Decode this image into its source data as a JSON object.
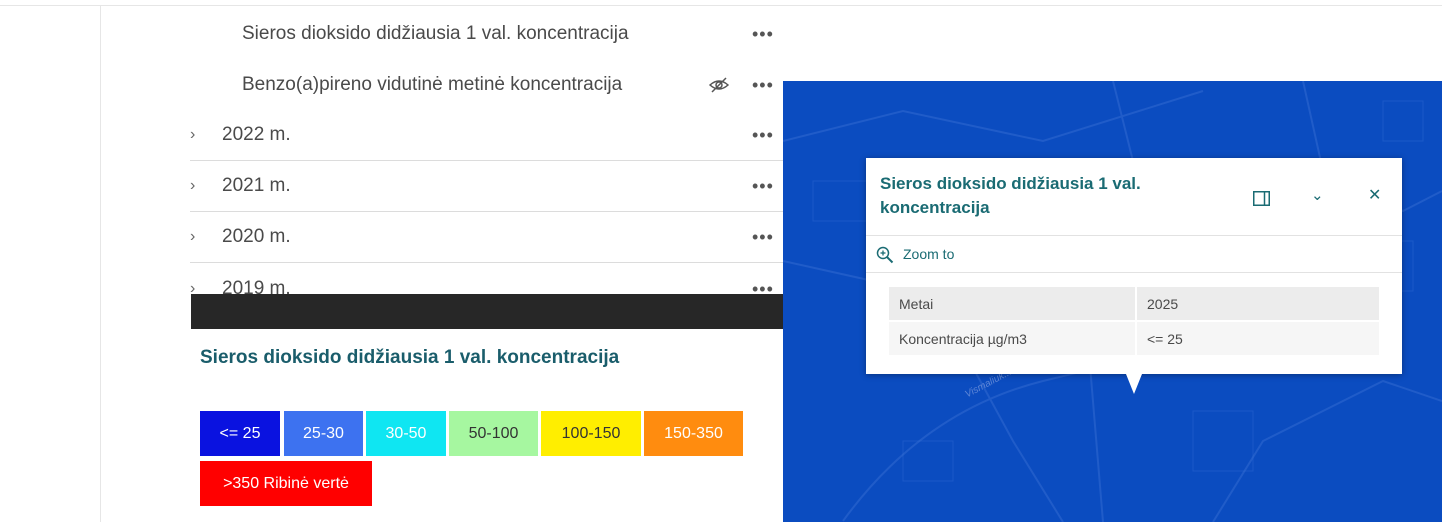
{
  "layer_list": {
    "sublayers": [
      {
        "label": "Sieros dioksido didžiausia 1 val. koncentracija",
        "more": "•••"
      },
      {
        "label": "Benzo(a)pireno vidutinė metinė koncentracija",
        "more": "•••",
        "visibility_icon": "eye-off-icon"
      }
    ],
    "years": [
      {
        "label": "2022 m.",
        "more": "•••",
        "chevron": "›"
      },
      {
        "label": "2021 m.",
        "more": "•••",
        "chevron": "›"
      },
      {
        "label": "2020 m.",
        "more": "•••",
        "chevron": "›"
      },
      {
        "label": "2019 m.",
        "more": "•••",
        "chevron": "›"
      }
    ]
  },
  "legend": {
    "title": "Sieros dioksido didžiausia 1 val. koncentracija",
    "classes": [
      {
        "label": "<= 25",
        "color": "#0a12e0"
      },
      {
        "label": "25-30",
        "color": "#3d72f0"
      },
      {
        "label": "30-50",
        "color": "#0fe6f2"
      },
      {
        "label": "50-100",
        "color": "#a6f7a0"
      },
      {
        "label": "100-150",
        "color": "#ffee00"
      },
      {
        "label": "150-350",
        "color": "#ff8c0f"
      },
      {
        "label": ">350 Ribinė vertė",
        "color": "#ff0000"
      }
    ]
  },
  "map": {
    "background": "#0b4cc0",
    "street_label": "Vismaliuk..."
  },
  "popup": {
    "title": "Sieros dioksido didžiausia 1 val. koncentracija",
    "dock_icon": "dock-icon",
    "collapse_icon": "⌄",
    "close_icon": "✕",
    "zoom_label": "Zoom to",
    "attributes": [
      {
        "key": "Metai",
        "value": "2025"
      },
      {
        "key": "Koncentracija µg/m3",
        "value": "<= 25"
      }
    ]
  }
}
